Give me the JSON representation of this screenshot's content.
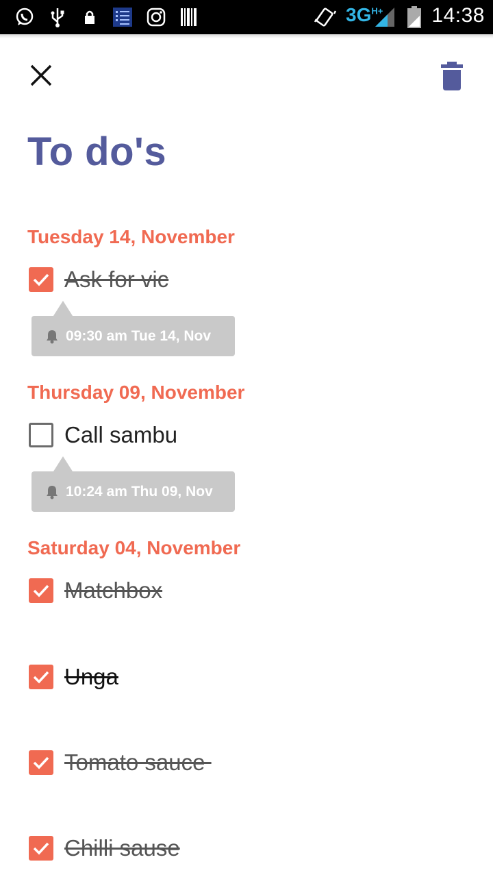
{
  "status_bar": {
    "time": "14:38",
    "network": "3G",
    "network_sup": "H+",
    "icons": [
      "whatsapp-icon",
      "usb-icon",
      "lock-icon",
      "checklist-app-icon",
      "instagram-icon",
      "barcode-icon",
      "vibrate-icon",
      "signal-icon",
      "battery-icon"
    ]
  },
  "toolbar": {
    "close_icon": "close-icon",
    "delete_icon": "trash-icon"
  },
  "page": {
    "title": "To do's"
  },
  "sections": [
    {
      "date": "Tuesday 14, November",
      "items": [
        {
          "text": "Ask for vic",
          "checked": true,
          "reminder": "09:30 am Tue 14, Nov"
        }
      ]
    },
    {
      "date": "Thursday 09, November",
      "items": [
        {
          "text": "Call sambu",
          "checked": false,
          "reminder": "10:24 am Thu 09, Nov"
        }
      ]
    },
    {
      "date": "Saturday 04, November",
      "items": [
        {
          "text": "Matchbox",
          "checked": true
        },
        {
          "text": "Unga",
          "checked": true
        },
        {
          "text": "Tomato sauce ",
          "checked": true
        },
        {
          "text": "Chilli sause",
          "checked": true
        }
      ]
    }
  ],
  "colors": {
    "accent": "#f06a52",
    "title": "#545b9c",
    "reminder_bg": "#c9c9c9",
    "status_bar": "#000000",
    "network": "#33b5e5"
  }
}
